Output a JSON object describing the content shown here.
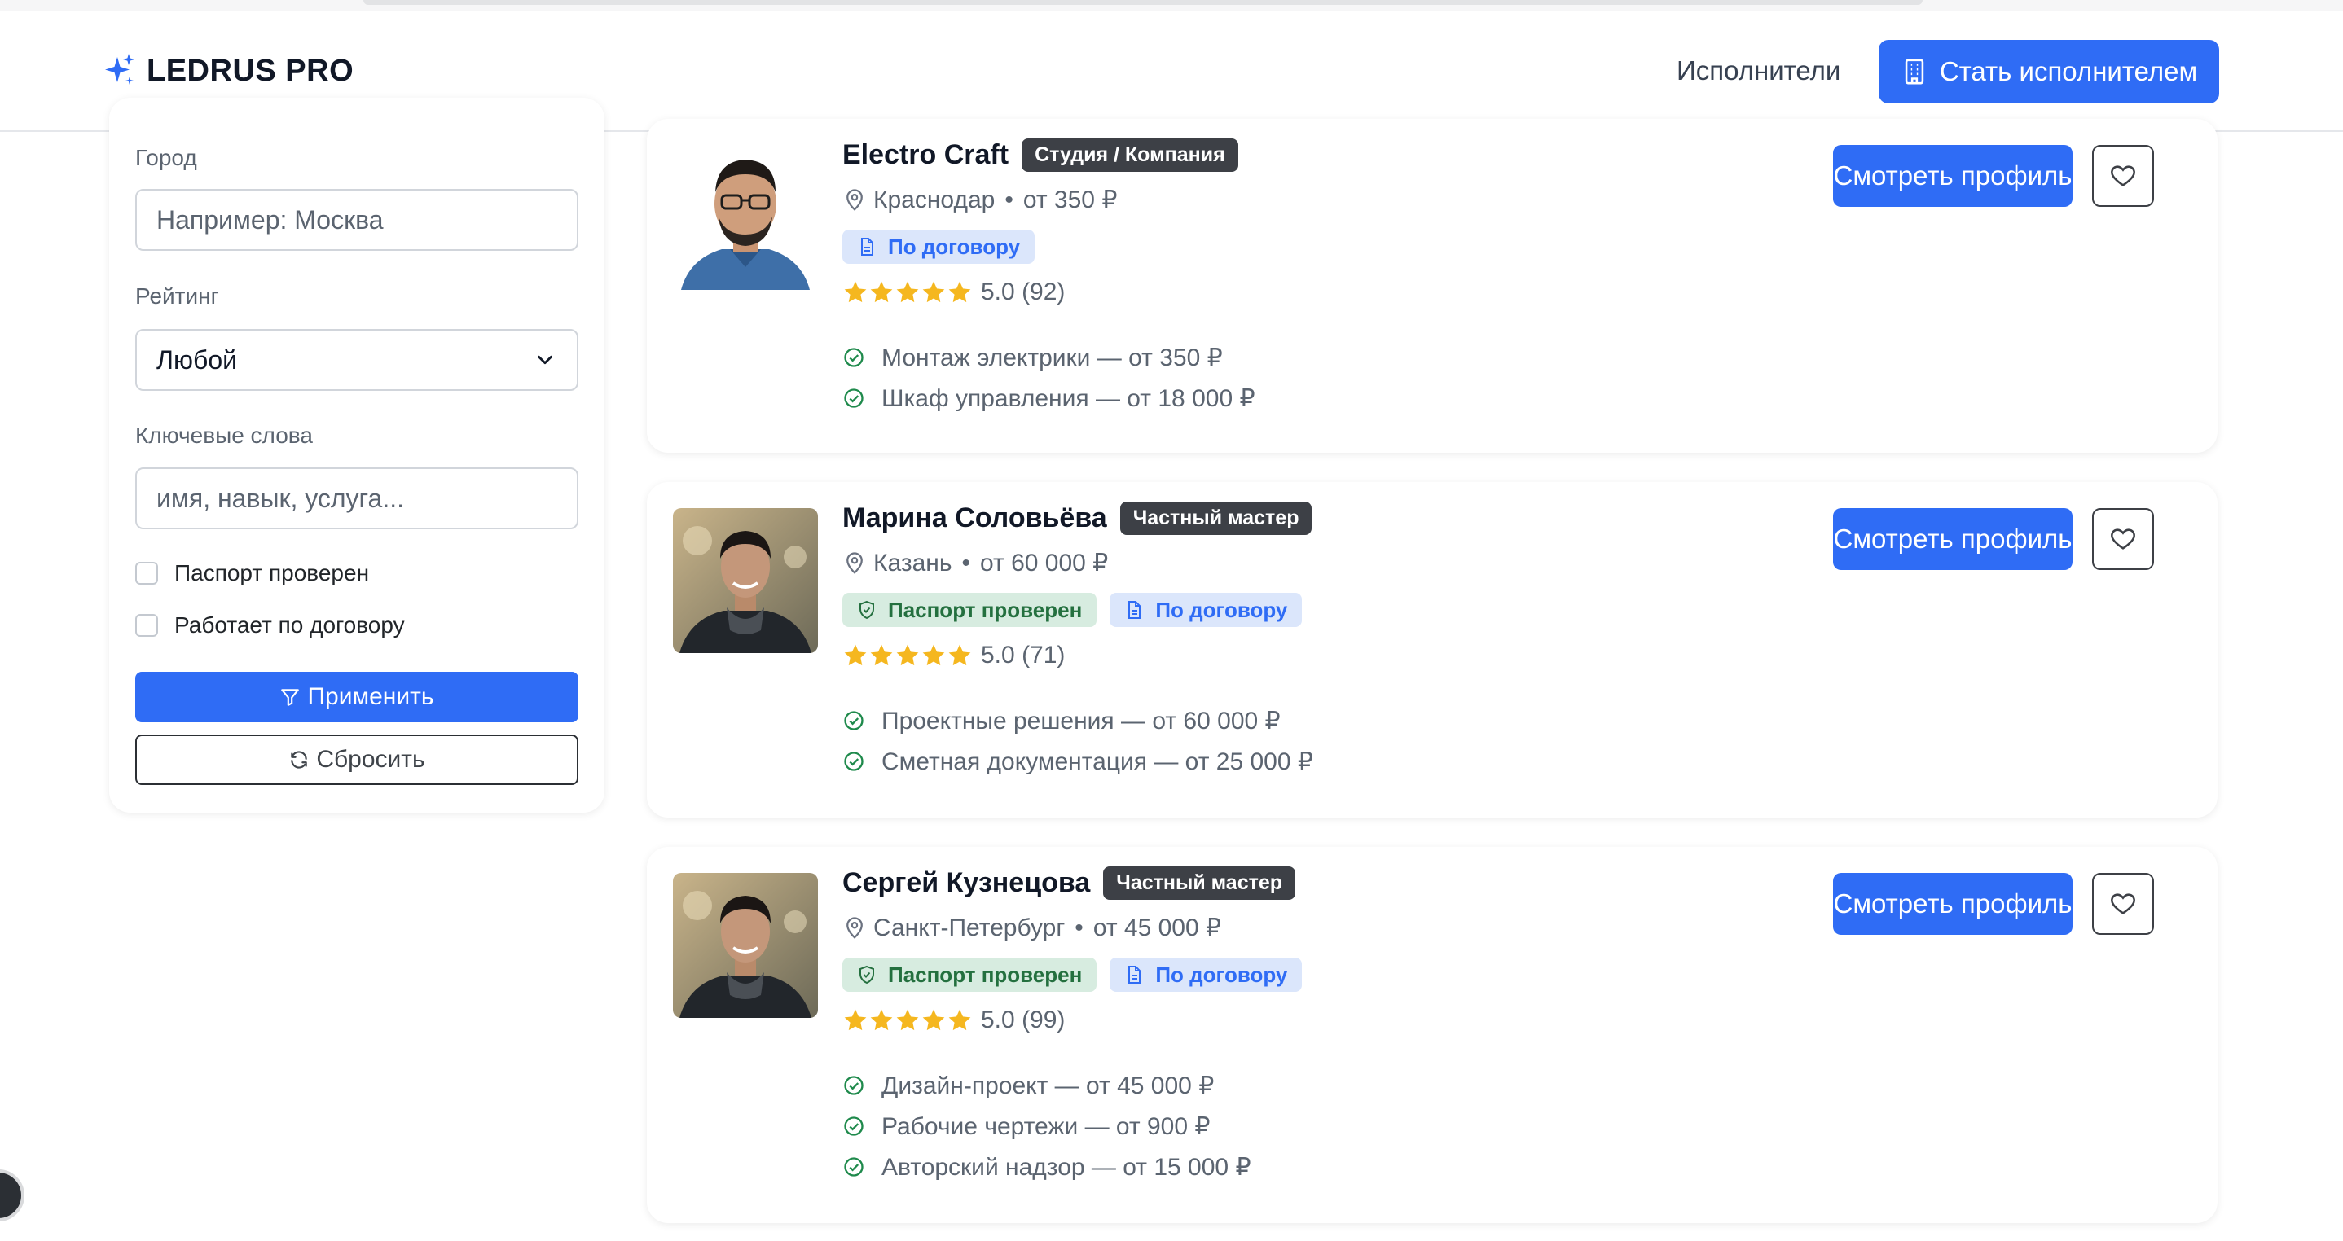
{
  "header": {
    "brand": "LEDRUS PRO",
    "nav_link": "Исполнители",
    "cta": "Стать исполнителем"
  },
  "filters": {
    "city_label": "Город",
    "city_placeholder": "Например: Москва",
    "rating_label": "Рейтинг",
    "rating_value": "Любой",
    "keywords_label": "Ключевые слова",
    "keywords_placeholder": "имя, навык, услуга...",
    "passport_label": "Паспорт проверен",
    "passport_checked": false,
    "contract_label": "Работает по договору",
    "contract_checked": false,
    "apply": "Применить",
    "reset": "Сбросить"
  },
  "providers": [
    {
      "name": "Electro Craft",
      "type": "Студия / Компания",
      "city": "Краснодар",
      "price": "от 350 ₽",
      "badges": [
        {
          "kind": "contract",
          "label": "По договору"
        }
      ],
      "rating": "5.0",
      "reviews": "(92)",
      "stars": 5,
      "services": [
        "Монтаж электрики — от 350 ₽",
        "Шкаф управления — от 18 000 ₽"
      ],
      "profile_button": "Смотреть профиль"
    },
    {
      "name": "Марина Соловьёва",
      "type": "Частный мастер",
      "city": "Казань",
      "price": "от 60 000 ₽",
      "badges": [
        {
          "kind": "passport",
          "label": "Паспорт проверен"
        },
        {
          "kind": "contract",
          "label": "По договору"
        }
      ],
      "rating": "5.0",
      "reviews": "(71)",
      "stars": 5,
      "services": [
        "Проектные решения — от 60 000 ₽",
        "Сметная документация — от 25 000 ₽"
      ],
      "profile_button": "Смотреть профиль"
    },
    {
      "name": "Сергей Кузнецова",
      "type": "Частный мастер",
      "city": "Санкт-Петербург",
      "price": "от 45 000 ₽",
      "badges": [
        {
          "kind": "passport",
          "label": "Паспорт проверен"
        },
        {
          "kind": "contract",
          "label": "По договору"
        }
      ],
      "rating": "5.0",
      "reviews": "(99)",
      "stars": 5,
      "services": [
        "Дизайн-проект — от 45 000 ₽",
        "Рабочие чертежи — от 900 ₽",
        "Авторский надзор — от 15 000 ₽"
      ],
      "profile_button": "Смотреть профиль"
    }
  ],
  "icons": {
    "brand": "sparkles-icon",
    "cta": "building-icon",
    "location": "map-pin-icon",
    "passport": "shield-check-icon",
    "contract": "document-icon",
    "service": "check-circle-icon",
    "favorite": "heart-icon",
    "apply": "filter-icon",
    "reset": "refresh-icon"
  },
  "colors": {
    "primary": "#2f6cf5",
    "star": "#f5b71f",
    "badge_dark": "#3d4046",
    "passport_bg": "#d7ece0",
    "passport_text": "#24703f",
    "contract_bg": "#dbe6fb"
  }
}
